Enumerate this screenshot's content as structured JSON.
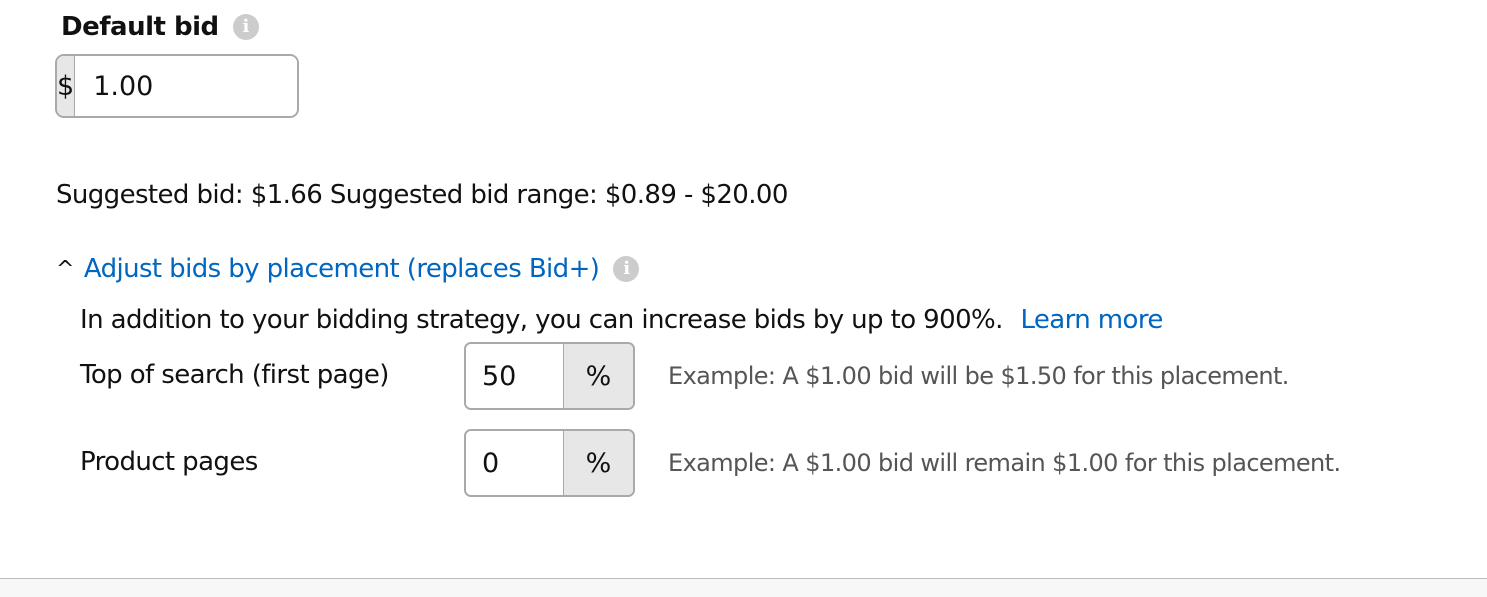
{
  "default_bid": {
    "title": "Default bid",
    "info_icon": "info-icon",
    "currency_symbol": "$",
    "value": "1.00"
  },
  "suggested": {
    "text": "Suggested bid: $1.66 Suggested bid range: $0.89 - $20.00"
  },
  "placement": {
    "toggle_caret": "^",
    "toggle_label": "Adjust bids by placement (replaces Bid+)",
    "info_icon": "info-icon",
    "description": "In addition to your bidding strategy, you can increase bids by up to 900%.",
    "learn_more": "Learn more",
    "rows": [
      {
        "label": "Top of search (first page)",
        "value": "50",
        "suffix": "%",
        "example": "Example: A $1.00 bid will be $1.50 for this placement."
      },
      {
        "label": "Product pages",
        "value": "0",
        "suffix": "%",
        "example": "Example: A $1.00 bid will remain $1.00 for this placement."
      }
    ]
  },
  "colors": {
    "link": "#0066c0",
    "addon_bg": "#e7e7e7",
    "border": "#a9a9a9",
    "info_icon": "#cccccc",
    "example_text": "#555555"
  }
}
